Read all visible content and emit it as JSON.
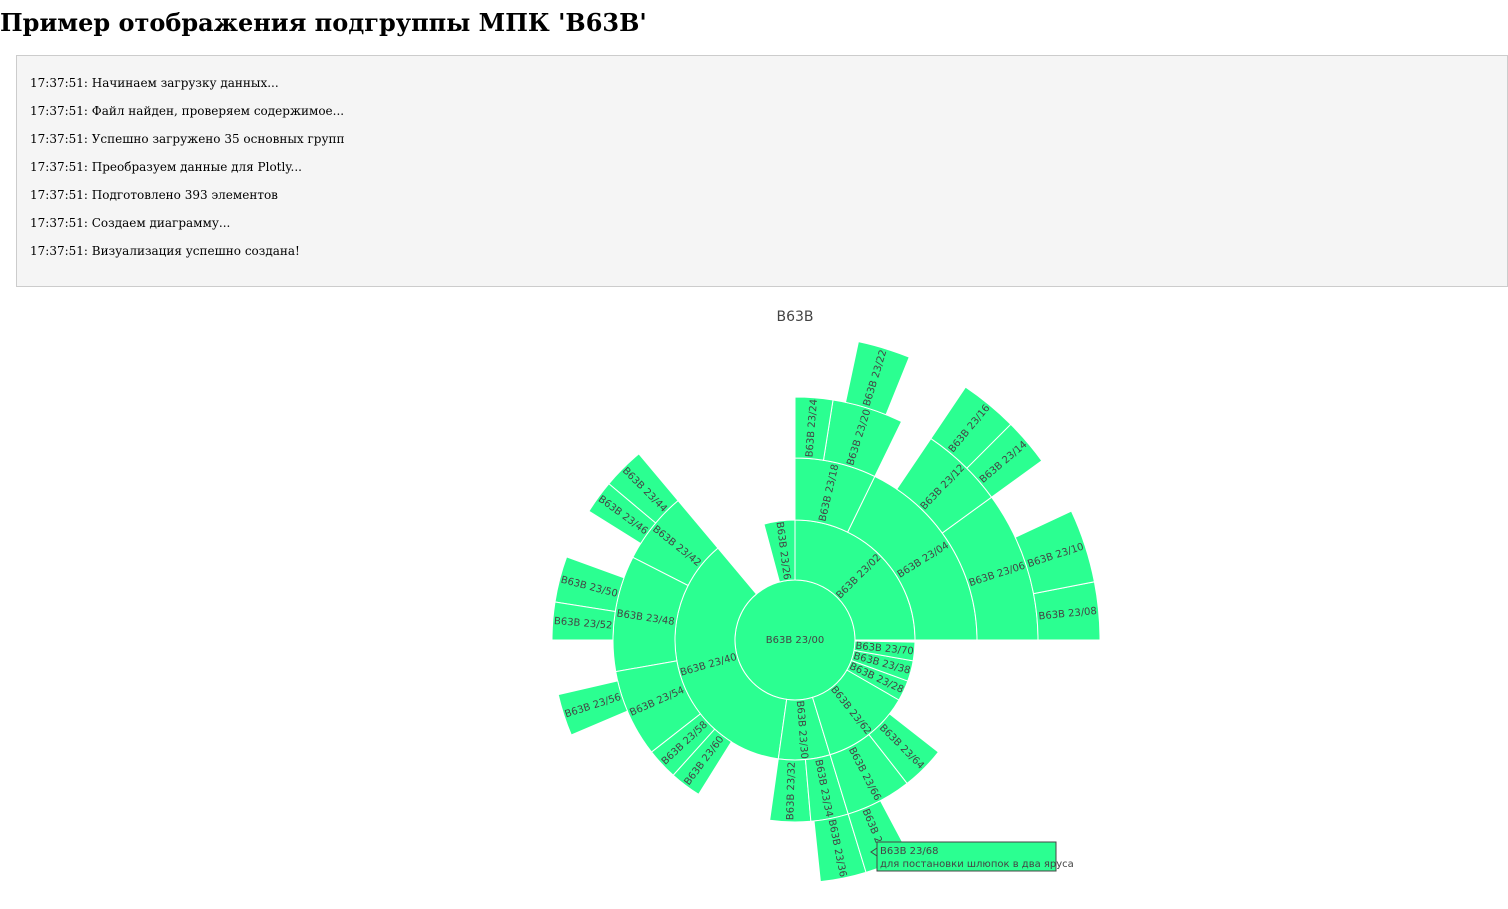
{
  "page": {
    "title": "Пример отображения подгруппы МПК 'B63B'"
  },
  "log": {
    "lines": [
      "17:37:51: Начинаем загрузку данных...",
      "17:37:51: Файл найден, проверяем содержимое...",
      "17:37:51: Успешно загружено 35 основных групп",
      "17:37:51: Преобразуем данные для Plotly...",
      "17:37:51: Подготовлено 393 элементов",
      "17:37:51: Создаем диаграмму...",
      "17:37:51: Визуализация успешно создана!"
    ]
  },
  "colors": {
    "segment_fill": "#2bff91",
    "segment_stroke": "#ffffff",
    "label_text": "#444444",
    "tooltip_border": "#444444"
  },
  "chart_data": {
    "type": "sunburst",
    "title": "B63B",
    "root": "B63B",
    "start_angle_deg": 0,
    "direction": "counterclockwise",
    "segments": [
      {
        "label": "B63B 23/00",
        "depth": 1,
        "start_deg": 0,
        "end_deg": 360
      },
      {
        "label": "B63B 23/02",
        "depth": 2,
        "start_deg": 0,
        "end_deg": 90
      },
      {
        "label": "B63B 23/04",
        "depth": 3,
        "start_deg": 0,
        "end_deg": 64
      },
      {
        "label": "B63B 23/06",
        "depth": 4,
        "start_deg": 0,
        "end_deg": 36
      },
      {
        "label": "B63B 23/08",
        "depth": 5,
        "start_deg": 0,
        "end_deg": 11
      },
      {
        "label": "B63B 23/10",
        "depth": 5,
        "start_deg": 11,
        "end_deg": 25
      },
      {
        "label": "B63B 23/12",
        "depth": 4,
        "start_deg": 36,
        "end_deg": 56
      },
      {
        "label": "B63B 23/14",
        "depth": 5,
        "start_deg": 36,
        "end_deg": 45
      },
      {
        "label": "B63B 23/16",
        "depth": 5,
        "start_deg": 45,
        "end_deg": 56
      },
      {
        "label": "B63B 23/18",
        "depth": 3,
        "start_deg": 64,
        "end_deg": 90
      },
      {
        "label": "B63B 23/20",
        "depth": 4,
        "start_deg": 64,
        "end_deg": 81
      },
      {
        "label": "B63B 23/22",
        "depth": 5,
        "start_deg": 68,
        "end_deg": 78
      },
      {
        "label": "B63B 23/24",
        "depth": 4,
        "start_deg": 81,
        "end_deg": 90
      },
      {
        "label": "B63B 23/26",
        "depth": 2,
        "start_deg": 90,
        "end_deg": 105
      },
      {
        "label": "B63B 23/40",
        "depth": 2,
        "start_deg": 130,
        "end_deg": 262
      },
      {
        "label": "B63B 23/42",
        "depth": 3,
        "start_deg": 130,
        "end_deg": 153
      },
      {
        "label": "B63B 23/44",
        "depth": 4,
        "start_deg": 130,
        "end_deg": 140
      },
      {
        "label": "B63B 23/46",
        "depth": 4,
        "start_deg": 140,
        "end_deg": 148
      },
      {
        "label": "B63B 23/48",
        "depth": 3,
        "start_deg": 153,
        "end_deg": 190
      },
      {
        "label": "B63B 23/50",
        "depth": 4,
        "start_deg": 160,
        "end_deg": 171
      },
      {
        "label": "B63B 23/52",
        "depth": 4,
        "start_deg": 171,
        "end_deg": 180
      },
      {
        "label": "B63B 23/54",
        "depth": 3,
        "start_deg": 190,
        "end_deg": 218
      },
      {
        "label": "B63B 23/56",
        "depth": 4,
        "start_deg": 193,
        "end_deg": 203
      },
      {
        "label": "B63B 23/58",
        "depth": 3,
        "start_deg": 218,
        "end_deg": 228
      },
      {
        "label": "B63B 23/60",
        "depth": 3,
        "start_deg": 228,
        "end_deg": 238
      },
      {
        "label": "B63B 23/30",
        "depth": 2,
        "start_deg": 262,
        "end_deg": 287
      },
      {
        "label": "B63B 23/32",
        "depth": 3,
        "start_deg": 262,
        "end_deg": 275
      },
      {
        "label": "B63B 23/34",
        "depth": 3,
        "start_deg": 275,
        "end_deg": 287
      },
      {
        "label": "B63B 23/36",
        "depth": 4,
        "start_deg": 276,
        "end_deg": 287
      },
      {
        "label": "B63B 23/62",
        "depth": 2,
        "start_deg": 287,
        "end_deg": 330
      },
      {
        "label": "B63B 23/64",
        "depth": 3,
        "start_deg": 308,
        "end_deg": 322
      },
      {
        "label": "B63B 23/66",
        "depth": 3,
        "start_deg": 287,
        "end_deg": 308
      },
      {
        "label": "B63B 23/68",
        "depth": 4,
        "start_deg": 287,
        "end_deg": 298
      },
      {
        "label": "B63B 23/28",
        "depth": 2,
        "start_deg": 330,
        "end_deg": 340
      },
      {
        "label": "B63B 23/38",
        "depth": 2,
        "start_deg": 340,
        "end_deg": 350
      },
      {
        "label": "B63B 23/70",
        "depth": 2,
        "start_deg": 350,
        "end_deg": 359
      }
    ],
    "tooltip": {
      "label": "B63B 23/68",
      "description": "для постановки шлюпок в два яруса"
    }
  }
}
